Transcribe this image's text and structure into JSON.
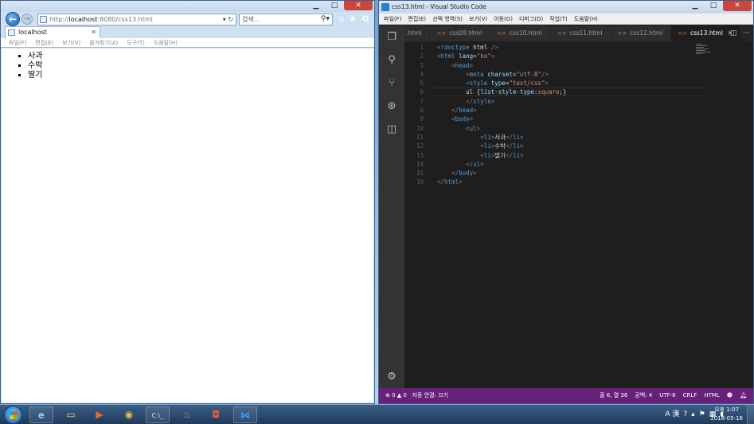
{
  "ie": {
    "address_prefix": "http://",
    "address_host": "localhost",
    "address_rest": ":8080/css13.html",
    "address_ctrls": "▾ ↻",
    "search_placeholder": "검색...",
    "tab_title": "localhost",
    "menu": [
      "파일(F)",
      "편집(E)",
      "보기(V)",
      "즐겨찾기(A)",
      "도구(T)",
      "도움말(H)"
    ],
    "list_items": [
      "사과",
      "수박",
      "딸기"
    ]
  },
  "vscode": {
    "title": "css13.html - Visual Studio Code",
    "menu": [
      "파일(F)",
      "편집(E)",
      "선택 영역(S)",
      "보기(V)",
      "이동(G)",
      "디버그(D)",
      "작업(T)",
      "도움말(H)"
    ],
    "tabs": [
      ".html",
      "css09.html",
      "css10.html",
      "css11.html",
      "css12.html",
      "css13.html"
    ],
    "active_tab": "css13.html",
    "line_numbers": [
      "1",
      "2",
      "3",
      "4",
      "5",
      "6",
      "7",
      "8",
      "9",
      "10",
      "11",
      "12",
      "13",
      "14",
      "15",
      "16"
    ],
    "code_lines": [
      "<!doctype html />",
      "<html lang=\"ko\">",
      "    <head>",
      "        <meta charset=\"utf-8\"/>",
      "        <style type=\"text/css\">",
      "        ul {list-style-type:square;}",
      "        </style>",
      "    </head>",
      "    <body>",
      "        <ul>",
      "            <li>사과</li>",
      "            <li>수박</li>",
      "            <li>딸기</li>",
      "        </ul>",
      "    </body>",
      "</html>"
    ],
    "status": {
      "problems": "⊗ 0 ▲ 0",
      "live": "자동 연결: 끄기",
      "position": "줄 6, 열 36",
      "spaces": "공백: 4",
      "encoding": "UTF-8",
      "eol": "CRLF",
      "language": "HTML"
    }
  },
  "taskbar": {
    "ime": "A 漢",
    "time": "오후 1:07",
    "date": "2018-05-16"
  },
  "colors": {
    "statusbar": "#68217a",
    "editor_bg": "#1e1e1e",
    "tag": "#569cd6",
    "attr": "#9cdcfe",
    "string": "#ce9178"
  }
}
